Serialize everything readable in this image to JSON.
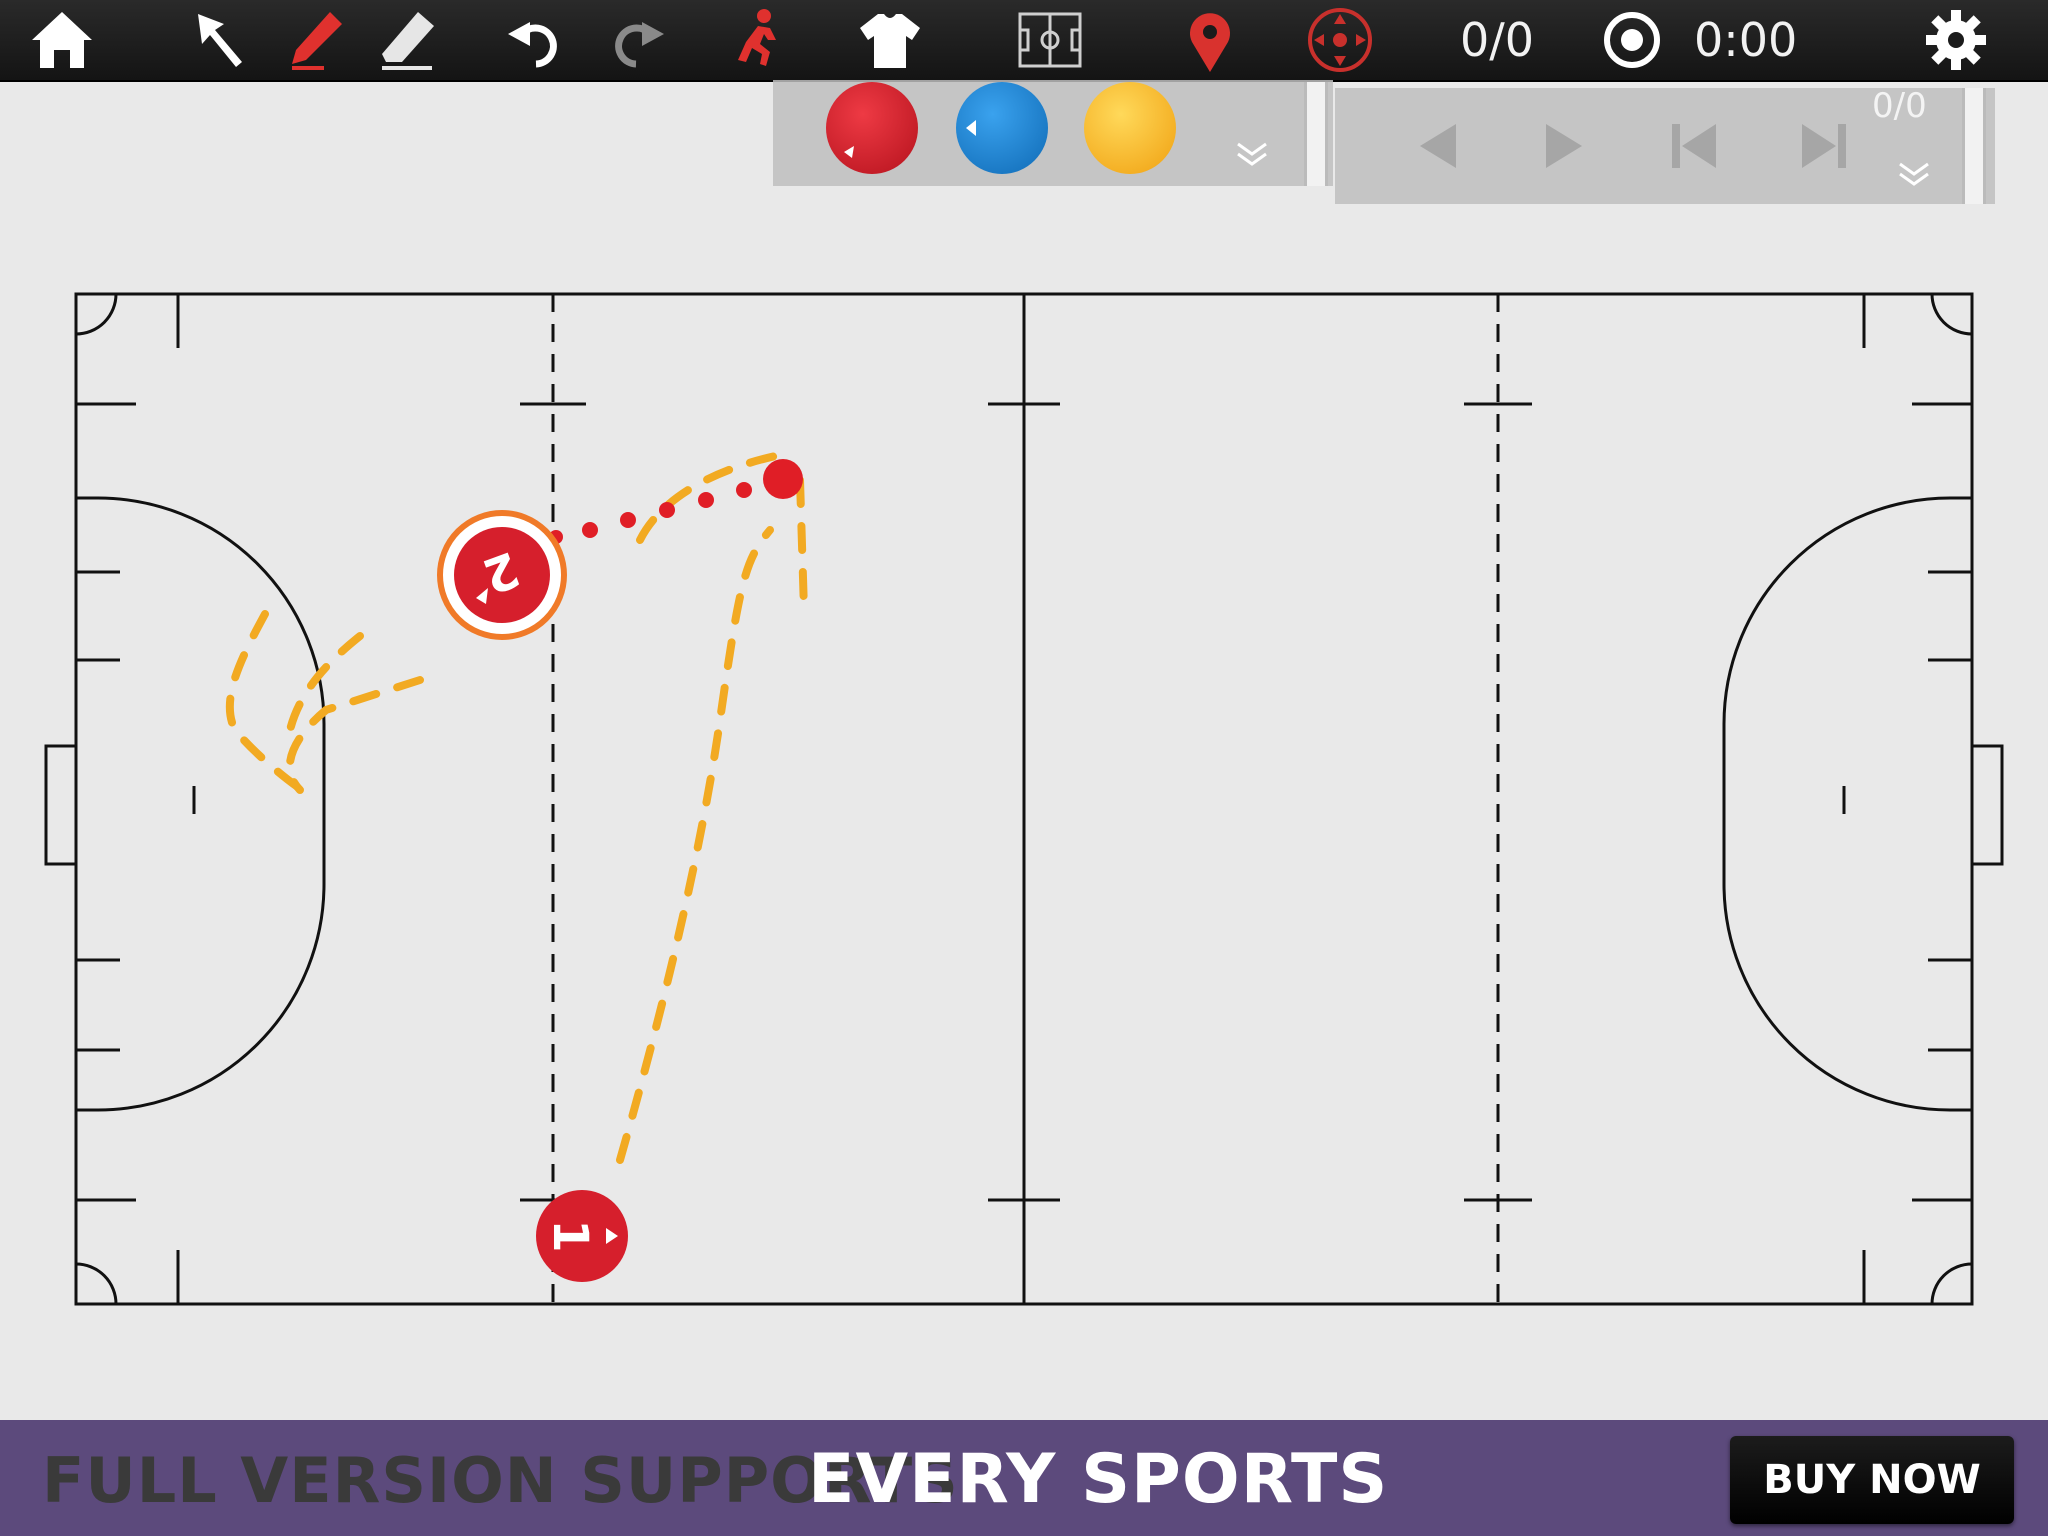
{
  "toolbar": {
    "score": "0/0",
    "timer": "0:00",
    "icons": [
      "home-icon",
      "select-arrow-icon",
      "pen-icon",
      "eraser-icon",
      "undo-icon",
      "redo-icon",
      "player-run-icon",
      "jersey-icon",
      "field-icon",
      "location-pin-icon",
      "target-icon",
      "record-icon",
      "settings-icon"
    ]
  },
  "pieces_panel": {
    "pieces": [
      {
        "name": "red-piece",
        "color": "#d61f2c"
      },
      {
        "name": "blue-piece",
        "color": "#1f86d8"
      },
      {
        "name": "yellow-piece",
        "color": "#f7b51c"
      }
    ]
  },
  "player_panel": {
    "counter": "0/0"
  },
  "players": [
    {
      "number": "2",
      "color": "#d61f2c",
      "selected": true
    },
    {
      "number": "1",
      "color": "#d61f2c",
      "selected": false
    }
  ],
  "colors": {
    "route": "#f2aa22",
    "pass": "#e01e26",
    "banner": "#5c4a7c"
  },
  "banner": {
    "text_gray": "FULL VERSION SUPPORTS",
    "text_white": "EVERY SPORTS",
    "button": "BUY NOW"
  }
}
